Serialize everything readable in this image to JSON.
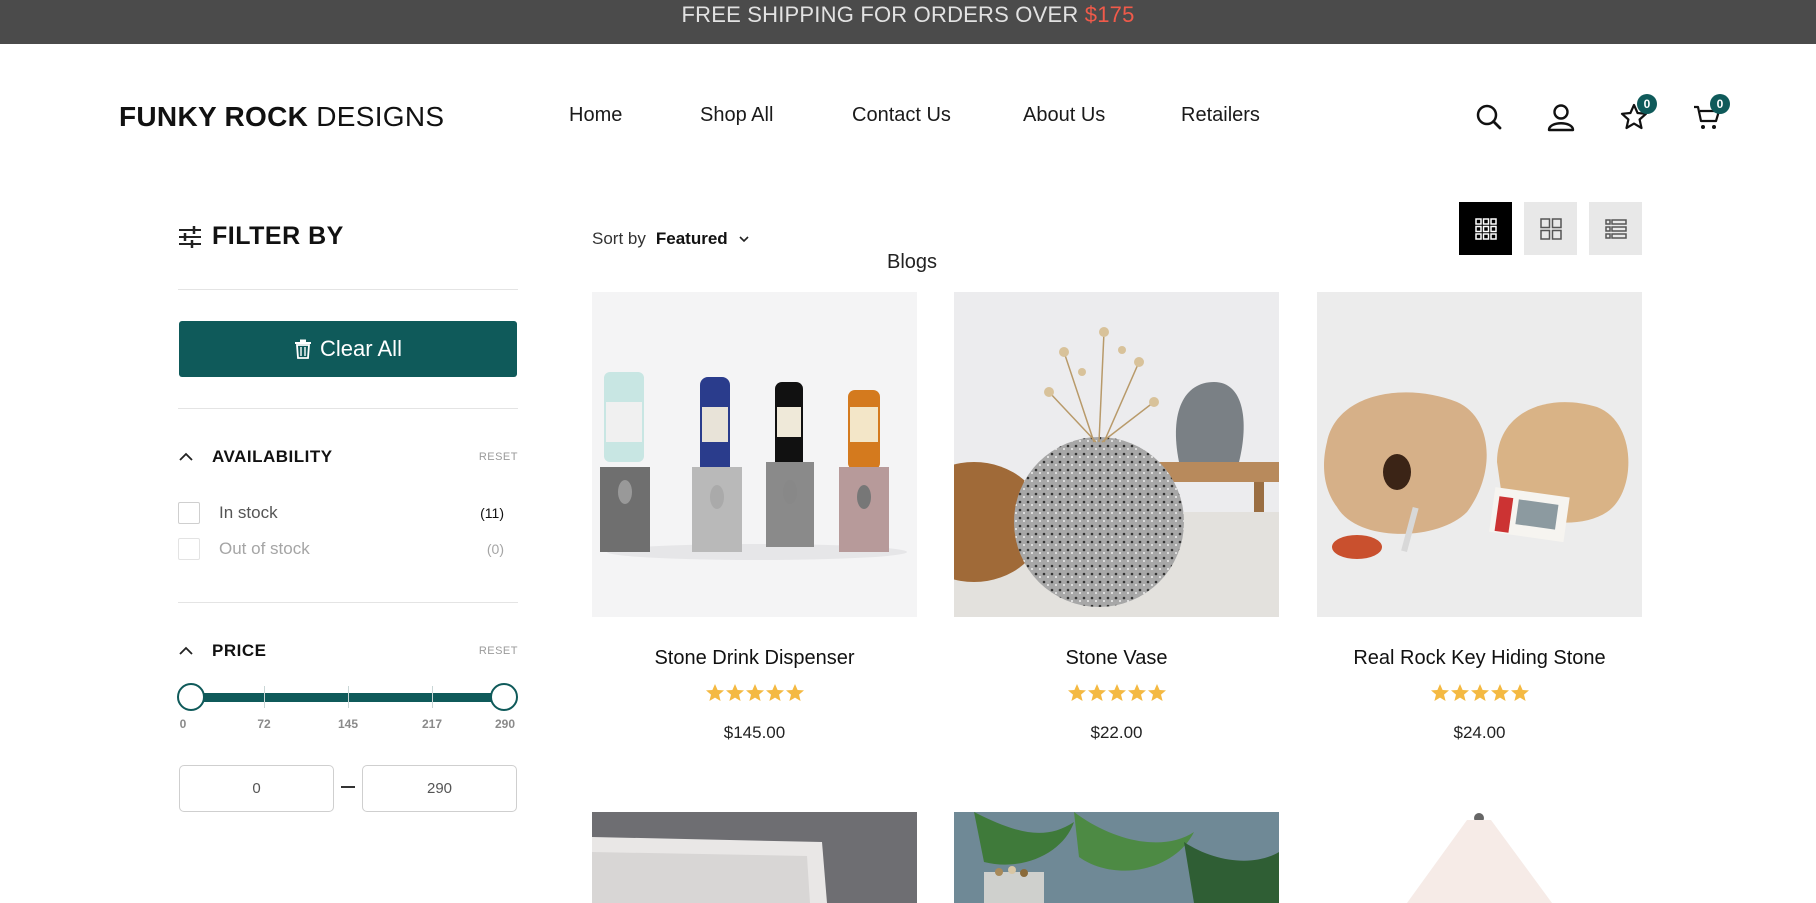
{
  "announcement": {
    "text": "FREE SHIPPING FOR ORDERS OVER ",
    "amount": "$175"
  },
  "brand": {
    "bold": "FUNKY ROCK",
    "light": " DESIGNS"
  },
  "nav": [
    "Home",
    "Shop All",
    "Contact Us",
    "About Us",
    "Retailers",
    "Blogs"
  ],
  "header_icons": {
    "search": "search-icon",
    "account": "user-icon",
    "wishlist": {
      "icon": "star-icon",
      "count": "0"
    },
    "cart": {
      "icon": "cart-icon",
      "count": "0"
    }
  },
  "filter": {
    "title": "FILTER BY",
    "clear_label": "Clear All",
    "availability": {
      "title": "AVAILABILITY",
      "reset": "RESET",
      "options": [
        {
          "label": "In stock",
          "count": "(11)"
        },
        {
          "label": "Out of stock",
          "count": "(0)"
        }
      ]
    },
    "price": {
      "title": "PRICE",
      "reset": "RESET",
      "min": "0",
      "max": "290",
      "ticks": [
        "0",
        "72",
        "145",
        "217",
        "290"
      ],
      "range_fill": 1.0
    }
  },
  "sort": {
    "label": "Sort by",
    "value": "Featured"
  },
  "view_modes": [
    "grid-3-icon",
    "grid-2-icon",
    "list-icon"
  ],
  "products": [
    {
      "title": "Stone Drink Dispenser",
      "price": "$145.00",
      "rating": 5
    },
    {
      "title": "Stone Vase",
      "price": "$22.00",
      "rating": 5
    },
    {
      "title": "Real Rock Key Hiding Stone",
      "price": "$24.00",
      "rating": 5
    }
  ],
  "colors": {
    "accent": "#0f5a5a",
    "topbar": "#4b4b4b",
    "highlight": "#f05a4a",
    "star": "#f4b942"
  }
}
